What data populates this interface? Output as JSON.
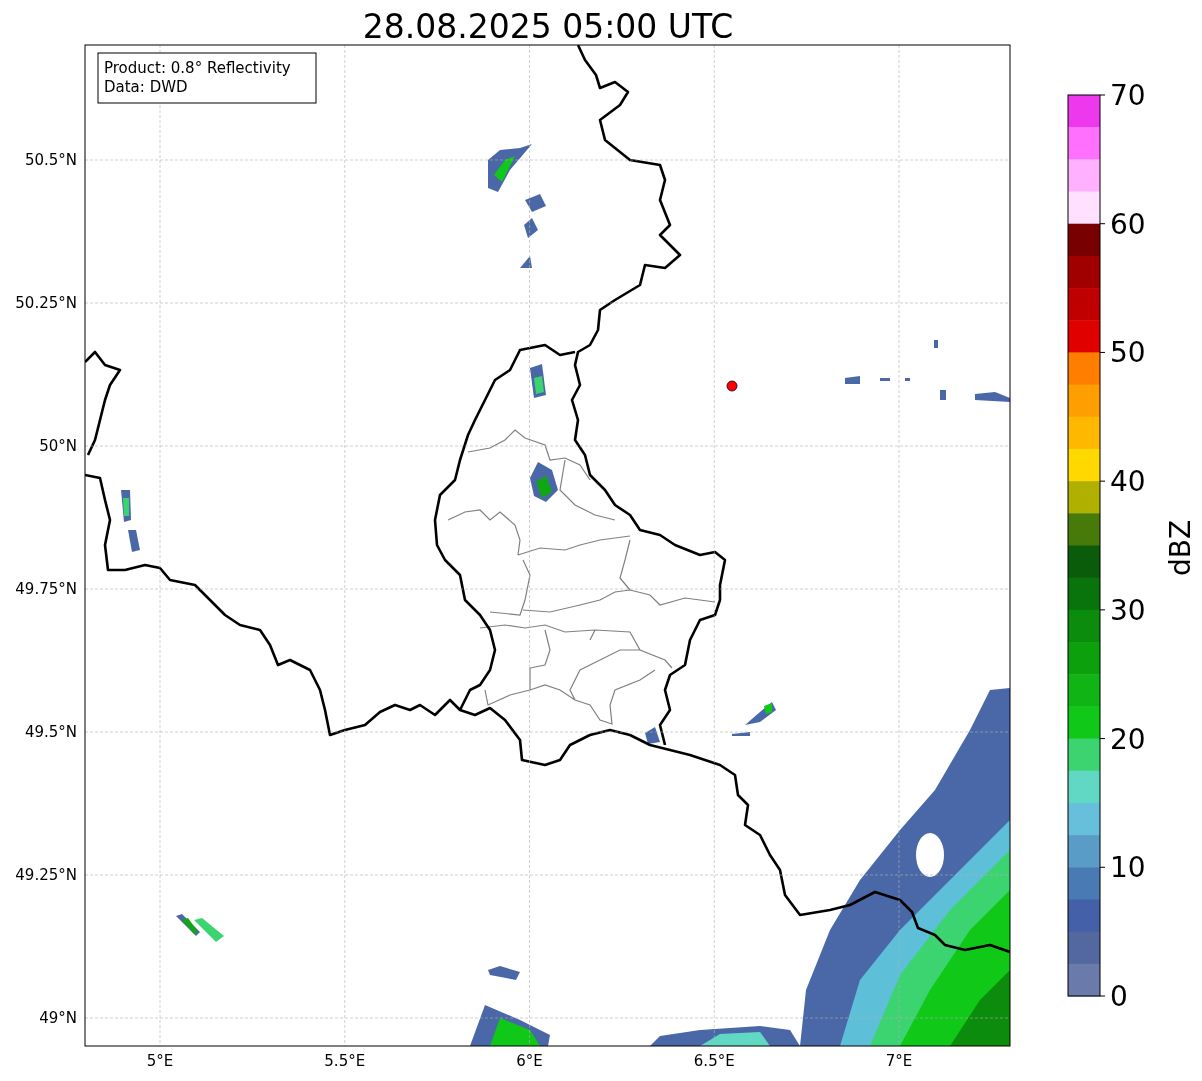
{
  "title": "28.08.2025 05:00 UTC",
  "info_box": [
    "Product: 0.8° Reflectivity",
    "Data: DWD"
  ],
  "map": {
    "x_tick_labels": [
      "5°E",
      "5.5°E",
      "6°E",
      "6.5°E",
      "7°E"
    ],
    "y_tick_labels": [
      "50.5°N",
      "50.25°N",
      "50°N",
      "49.75°N",
      "49.5°N",
      "49.25°N",
      "49°N"
    ]
  },
  "colorbar": {
    "label": "dBZ",
    "tick_labels": [
      "70",
      "60",
      "50",
      "40",
      "30",
      "20",
      "10",
      "0"
    ],
    "segments": [
      {
        "color": "#ee38ee"
      },
      {
        "color": "#ff70ff"
      },
      {
        "color": "#ffb0ff"
      },
      {
        "color": "#ffe0ff"
      },
      {
        "color": "#780000"
      },
      {
        "color": "#a00000"
      },
      {
        "color": "#c00000"
      },
      {
        "color": "#e00000"
      },
      {
        "color": "#ff7e00"
      },
      {
        "color": "#ff9e00"
      },
      {
        "color": "#ffb800"
      },
      {
        "color": "#ffd800"
      },
      {
        "color": "#b0b000"
      },
      {
        "color": "#487a0a"
      },
      {
        "color": "#0a5c0a"
      },
      {
        "color": "#0a740c"
      },
      {
        "color": "#0c8c0c"
      },
      {
        "color": "#0ca00c"
      },
      {
        "color": "#10b414"
      },
      {
        "color": "#10c818"
      },
      {
        "color": "#3cd470"
      },
      {
        "color": "#60d8c4"
      },
      {
        "color": "#66c0dc"
      },
      {
        "color": "#5a9cc8"
      },
      {
        "color": "#4a7ab4"
      },
      {
        "color": "#4460a8"
      },
      {
        "color": "#5468a0"
      },
      {
        "color": "#6a7aab"
      }
    ]
  }
}
